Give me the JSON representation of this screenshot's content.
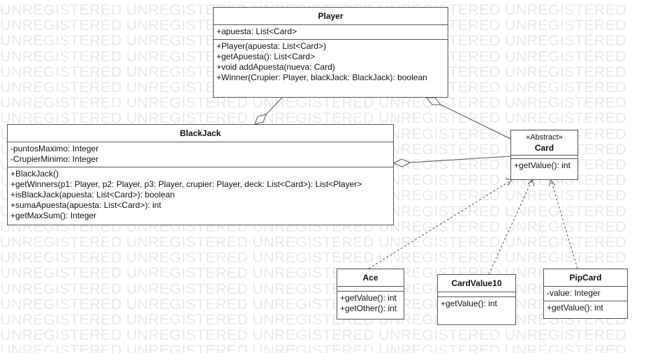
{
  "watermark": {
    "text": "UNREGISTERED UNREGISTERED UNREGISTERED UNREGISTERED UNREGISTERED",
    "rows": 23
  },
  "classes": {
    "player": {
      "name": "Player",
      "attributes": [
        "+apuesta: List<Card>"
      ],
      "operations": [
        "+Player(apuesta: List<Card>)",
        "+getApuesta(): List<Card>",
        "+void addApuesta(nueva: Card)",
        "+Winner(Crupier: Player, blackJack: BlackJack): boolean"
      ]
    },
    "blackjack": {
      "name": "BlackJack",
      "attributes": [
        "-puntosMaximo: Integer",
        "-CrupierMinimo: Integer"
      ],
      "operations": [
        "+BlackJack()",
        "+getWinners(p1: Player, p2: Player, p3: Player, crupier: Player, deck: List<Card>): List<Player>",
        "+isBlackJack(apuesta: List<Card>): boolean",
        "+sumaApuesta(apuesta: List<Card>): int",
        "+getMaxSum(): Integer"
      ]
    },
    "card": {
      "stereotype": "«Abstract»",
      "name": "Card",
      "operations": [
        "+getValue(): int"
      ]
    },
    "ace": {
      "name": "Ace",
      "attributes": [],
      "operations": [
        "+getValue(): int",
        "+getOther(): int"
      ]
    },
    "cardvalue10": {
      "name": "CardValue10",
      "attributes": [],
      "operations": [
        "+getValue(): int"
      ]
    },
    "pipcard": {
      "name": "PipCard",
      "attributes": [
        "-value: Integer"
      ],
      "operations": [
        "+getValue(): int"
      ]
    }
  },
  "relationships": [
    {
      "kind": "aggregation",
      "whole": "blackjack",
      "part": "player"
    },
    {
      "kind": "aggregation",
      "whole": "blackjack",
      "part": "card"
    },
    {
      "kind": "aggregation",
      "whole": "player",
      "part": "card"
    },
    {
      "kind": "realization",
      "from": "ace",
      "to": "card"
    },
    {
      "kind": "realization",
      "from": "cardvalue10",
      "to": "card"
    },
    {
      "kind": "realization",
      "from": "pipcard",
      "to": "card"
    }
  ],
  "colors": {
    "border": "#555555",
    "text": "#111111",
    "watermark": "#e9e9e9",
    "background": "#ffffff"
  }
}
